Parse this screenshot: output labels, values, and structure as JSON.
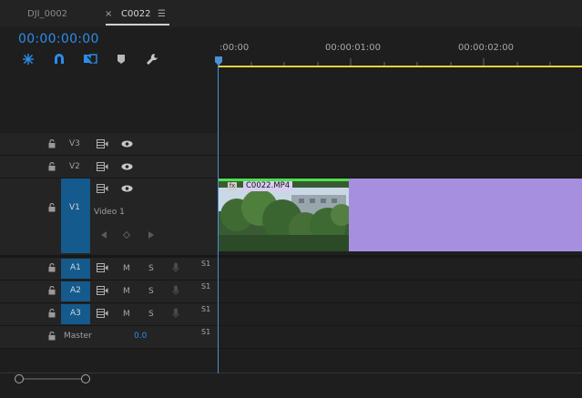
{
  "tabs": {
    "inactive": "DJI_0002",
    "close_symbol": "×",
    "active": "C0022",
    "menu_symbol": "☰"
  },
  "timecode": "00:00:00:00",
  "toolbar": {
    "tools": [
      "snowflake-nest-icon",
      "magnet-snap-icon",
      "linked-selection-icon",
      "marker-icon",
      "wrench-icon"
    ]
  },
  "ruler": {
    "labels": [
      ":00:00",
      "00:00:01:00",
      "00:00:02:00"
    ]
  },
  "tracks": {
    "video": [
      {
        "id": "V3"
      },
      {
        "id": "V2"
      },
      {
        "id": "V1",
        "name": "Video 1"
      }
    ],
    "audio": [
      {
        "id": "A1",
        "mute": "M",
        "solo": "S",
        "level": "S1"
      },
      {
        "id": "A2",
        "mute": "M",
        "solo": "S",
        "level": "S1"
      },
      {
        "id": "A3",
        "mute": "M",
        "solo": "S",
        "level": "S1"
      }
    ],
    "master": {
      "label": "Master",
      "value": "0.0",
      "level": "S1"
    }
  },
  "clip": {
    "fx_label": "fx",
    "name": "C0022.MP4"
  },
  "colors": {
    "accent_blue": "#2d8ceb",
    "track_target_blue": "#145a8c",
    "work_area_yellow": "#e6d33c",
    "clip_purple": "#a78fdf",
    "playhead_blue": "#4a90d6"
  }
}
